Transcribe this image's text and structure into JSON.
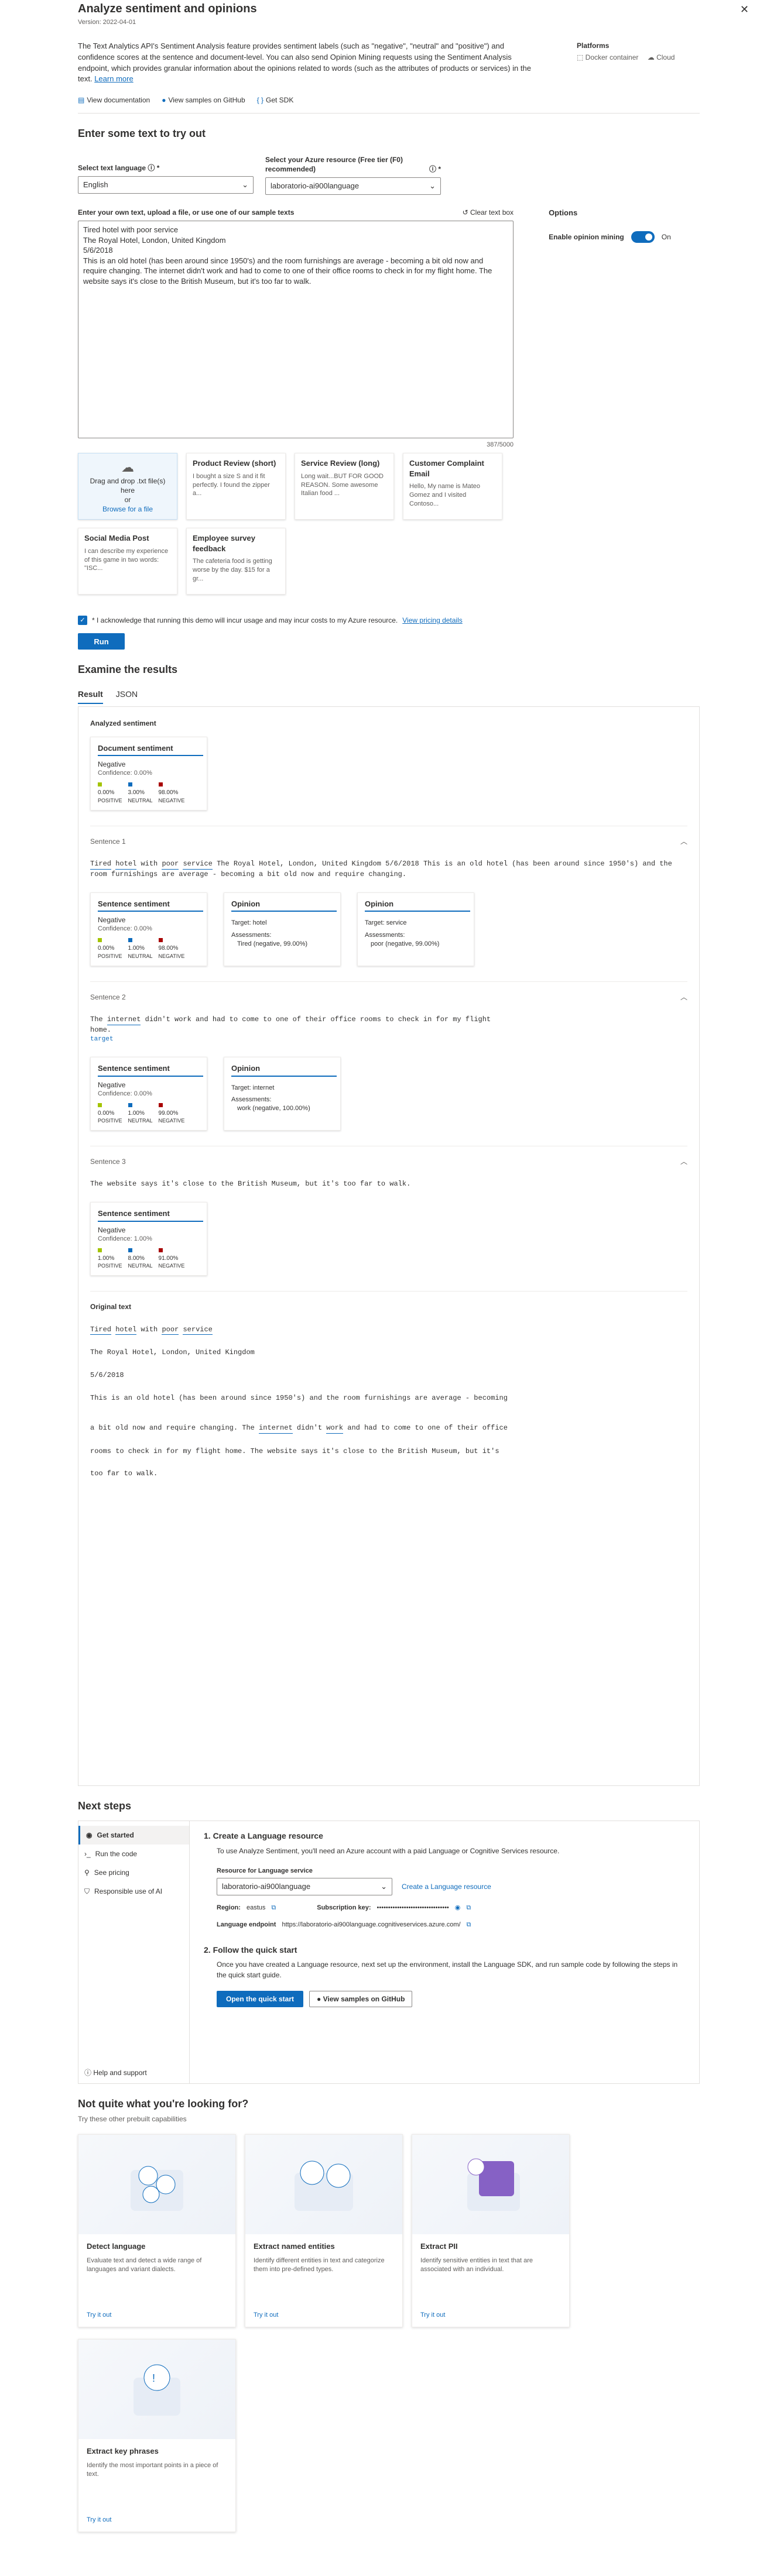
{
  "header": {
    "title": "Analyze sentiment and opinions",
    "version": "Version: 2022-04-01",
    "description": "The Text Analytics API's Sentiment Analysis feature provides sentiment labels (such as \"negative\", \"neutral\" and \"positive\") and confidence scores at the sentence and document-level. You can also send Opinion Mining requests using the Sentiment Analysis endpoint, which provides granular information about the opinions related to words (such as the attributes of products or services) in the text.",
    "learn_more": "Learn more",
    "platforms_label": "Platforms",
    "platforms": [
      "Docker container",
      "Cloud"
    ],
    "links": [
      "View documentation",
      "View samples on GitHub",
      "Get SDK"
    ]
  },
  "tryout": {
    "heading": "Enter some text to try out",
    "language_label": "Select text language",
    "language_value": "English",
    "resource_label": "Select your Azure resource (Free tier (F0) recommended)",
    "resource_value": "laboratorio-ai900language",
    "editor_label": "Enter your own text, upload a file, or use one of our sample texts",
    "clear_label": "Clear text box",
    "text_lines": [
      "Tired hotel with poor service",
      "The Royal Hotel, London, United Kingdom",
      "5/6/2018",
      "This is an old hotel (has been around since 1950's) and the room furnishings are average - becoming a bit old now and require changing. The internet didn't work and had to come to one of their office rooms to check in for my flight home. The website says it's close to the British Museum, but it's too far to walk."
    ],
    "char_count": "387/5000",
    "options_heading": "Options",
    "opinion_mining_label": "Enable opinion mining",
    "opinion_mining_state": "On"
  },
  "samples": {
    "upload_title": "Drag and drop .txt file(s) here",
    "upload_or": "or",
    "upload_link": "Browse for a file",
    "items": [
      {
        "title": "Product Review (short)",
        "text": "I bought a size S and it fit perfectly. I found the zipper a..."
      },
      {
        "title": "Service Review (long)",
        "text": "Long wait...BUT FOR GOOD REASON. Some awesome Italian food ..."
      },
      {
        "title": "Customer Complaint Email",
        "text": "Hello, My name is Mateo Gomez and I visited Contoso..."
      },
      {
        "title": "Social Media Post",
        "text": "I can describe my experience of this game in two words: \"ISC..."
      },
      {
        "title": "Employee survey feedback",
        "text": "The cafeteria food is getting worse by the day. $15 for a gr..."
      }
    ]
  },
  "ack": {
    "text": "* I acknowledge that running this demo will incur usage and may incur costs to my Azure resource.",
    "link": "View pricing details"
  },
  "run_label": "Run",
  "results": {
    "heading": "Examine the results",
    "tabs": [
      "Result",
      "JSON"
    ],
    "analyzed_label": "Analyzed sentiment",
    "document": {
      "title": "Document sentiment",
      "label": "Negative",
      "confidence": "Confidence: 0.00%",
      "scores": [
        {
          "value": "0.00%",
          "name": "POSITIVE",
          "color": "#a4c400"
        },
        {
          "value": "3.00%",
          "name": "NEUTRAL",
          "color": "#0f6cbd"
        },
        {
          "value": "98.00%",
          "name": "NEGATIVE",
          "color": "#a80000"
        }
      ]
    },
    "sentences": [
      {
        "name": "Sentence 1",
        "text": "The Royal Hotel, London, United Kingdom  5/6/2018  This is an old hotel (has been around since 1950's) and the room furnishings are average - becoming a bit old now and require changing.",
        "sentiment": {
          "label": "Negative",
          "confidence": "Confidence: 0.00%",
          "scores": [
            "0.00%",
            "1.00%",
            "98.00%"
          ]
        },
        "opinions": [
          {
            "title": "Opinion",
            "target": "Target: hotel",
            "assess_label": "Assessments:",
            "assess": "Tired (negative, 99.00%)"
          },
          {
            "title": "Opinion",
            "target": "Target: service",
            "assess_label": "Assessments:",
            "assess": "poor (negative, 99.00%)"
          }
        ]
      },
      {
        "name": "Sentence 2",
        "text": "didn't work and had to come to one of their office rooms to check in for my flight",
        "tail": "home.",
        "sentiment": {
          "label": "Negative",
          "confidence": "Confidence: 0.00%",
          "scores": [
            "0.00%",
            "1.00%",
            "99.00%"
          ]
        },
        "opinions": [
          {
            "title": "Opinion",
            "target": "Target: internet",
            "assess_label": "Assessments:",
            "assess": "work (negative, 100.00%)"
          }
        ]
      },
      {
        "name": "Sentence 3",
        "text": "The website says it's close to the British Museum, but it's too far to walk.",
        "sentiment": {
          "label": "Negative",
          "confidence": "Confidence: 1.00%",
          "scores": [
            "1.00%",
            "8.00%",
            "91.00%"
          ]
        }
      }
    ],
    "original_label": "Original text",
    "tag_target": "target",
    "original_lines": [
      "The Royal Hotel, London, United Kingdom",
      "5/6/2018",
      "This is an old hotel (has been around since 1950's) and the room furnishings are average - becoming",
      "rooms to check in for my flight home. The website says it's close to the British Museum, but it's",
      "too far to walk."
    ],
    "score_names": [
      "POSITIVE",
      "NEUTRAL",
      "NEGATIVE"
    ],
    "sentiment_title": "Sentence sentiment"
  },
  "next_steps": {
    "heading": "Next steps",
    "nav": [
      "Get started",
      "Run the code",
      "See pricing",
      "Responsible use of AI"
    ],
    "help": "Help and support",
    "step1_title": "1. Create a Language resource",
    "step1_text": "To use Analyze Sentiment, you'll need an Azure account with a paid Language or Cognitive Services resource.",
    "resource_label": "Resource for Language service",
    "resource_value": "laboratorio-ai900language",
    "create_link": "Create a Language resource",
    "region_label": "Region:",
    "region_value": "eastus",
    "key_label": "Subscription key:",
    "key_value": "••••••••••••••••••••••••••••••••",
    "endpoint_label": "Language endpoint",
    "endpoint_value": "https://laboratorio-ai900language.cognitiveservices.azure.com/",
    "step2_title": "2. Follow the quick start",
    "step2_text": "Once you have created a Language resource, next set up the environment, install the Language SDK, and run sample code by following the steps in the quick start guide.",
    "quickstart_btn": "Open the quick start",
    "github_btn": "View samples on GitHub"
  },
  "prebuilt": {
    "heading": "Not quite what you're looking for?",
    "sub": "Try these other prebuilt capabilities",
    "try_label": "Try it out",
    "items": [
      {
        "title": "Detect language",
        "desc": "Evaluate text and detect a wide range of languages and variant dialects."
      },
      {
        "title": "Extract named entities",
        "desc": "Identify different entities in text and categorize them into pre-defined types."
      },
      {
        "title": "Extract PII",
        "desc": "Identify sensitive entities in text that are associated with an individual."
      },
      {
        "title": "Extract key phrases",
        "desc": "Identify the most important points in a piece of text."
      }
    ]
  }
}
